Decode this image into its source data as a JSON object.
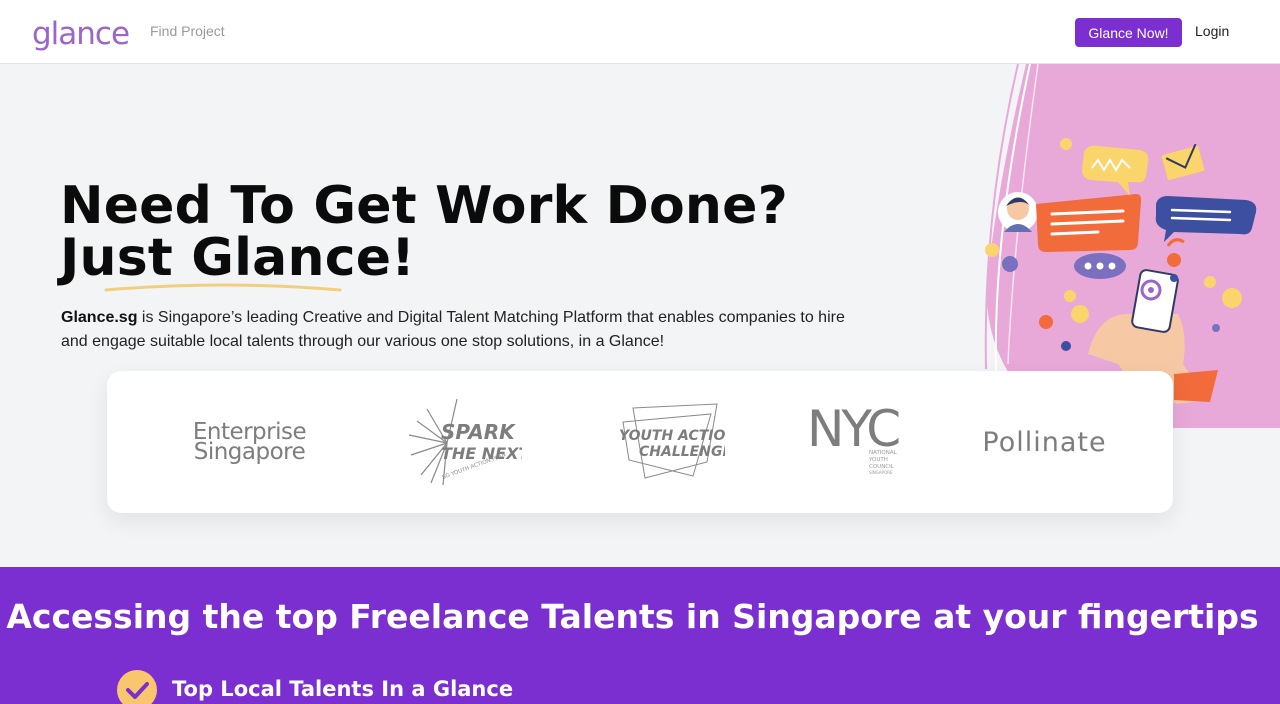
{
  "nav": {
    "logo_text": "glance",
    "find_project": "Find Project",
    "cta_label": "Glance Now!",
    "login_label": "Login"
  },
  "hero": {
    "title_line1": "Need To Get Work Done?",
    "title_line2": "Just Glance!",
    "desc_brand": "Glance.sg",
    "desc_text": " is Singapore’s leading Creative and Digital Talent Matching Platform that enables companies to hire and engage suitable local talents through our various one stop solutions, in a Glance!"
  },
  "partners": {
    "enterprise_line1": "Enterprise",
    "enterprise_line2": "Singapore",
    "spark_line1": "SPARK",
    "spark_line2": "THE NEXT",
    "spark_sub": "SG YOUTH ACTION PLAN",
    "youth_line1": "YOUTH ACTION",
    "youth_line2": "CHALLENGE",
    "nyc_text": "NYC",
    "nyc_sub1": "NATIONAL",
    "nyc_sub2": "YOUTH",
    "nyc_sub3": "COUNCIL",
    "nyc_sub4": "SINGAPORE",
    "pollinate_text": "Pollinate"
  },
  "section": {
    "title": "Accessing the top Freelance Talents in Singapore at your fingertips",
    "feature_1": "Top Local Talents In a Glance"
  },
  "colors": {
    "brand_purple": "#7b2fd0",
    "logo_purple": "#9b66c9",
    "illustration_pink": "#e8a8d8",
    "accent_yellow": "#f9c66d"
  },
  "icons": {
    "logo_mark": "eye-logo-icon",
    "feature_check": "check-circle-icon"
  }
}
